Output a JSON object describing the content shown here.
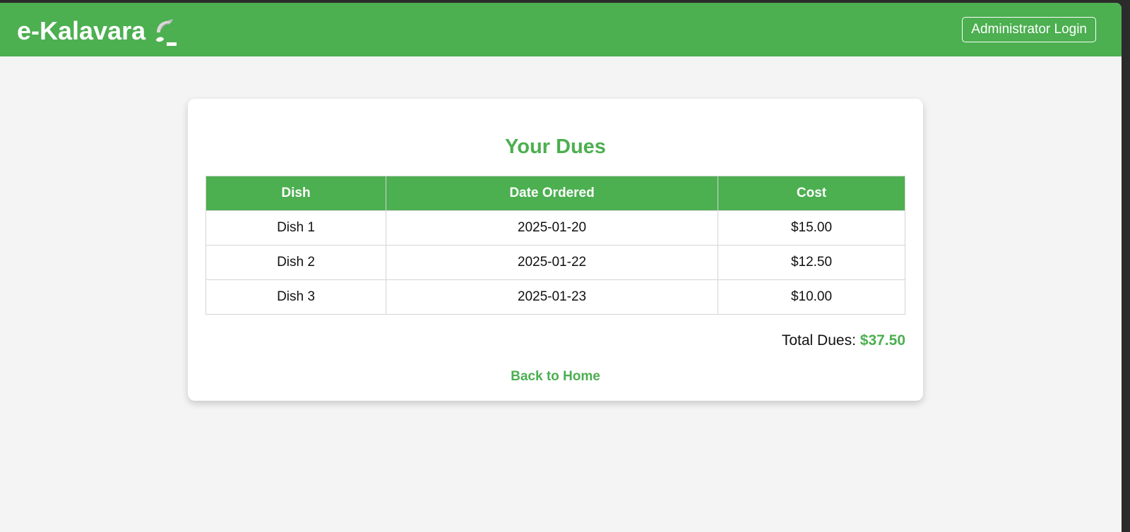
{
  "header": {
    "brand": "e-Kalavara",
    "admin_login": "Administrator Login"
  },
  "colors": {
    "accent": "#4caf50",
    "background": "#f4f4f4"
  },
  "icons": {
    "brand": "wrapped-food-icon"
  },
  "dues": {
    "title": "Your Dues",
    "columns": [
      "Dish",
      "Date Ordered",
      "Cost"
    ],
    "rows": [
      {
        "dish": "Dish 1",
        "date": "2025-01-20",
        "cost": "$15.00"
      },
      {
        "dish": "Dish 2",
        "date": "2025-01-22",
        "cost": "$12.50"
      },
      {
        "dish": "Dish 3",
        "date": "2025-01-23",
        "cost": "$10.00"
      }
    ],
    "total_label": "Total Dues:",
    "total_value": "$37.50",
    "back_link": "Back to Home"
  }
}
